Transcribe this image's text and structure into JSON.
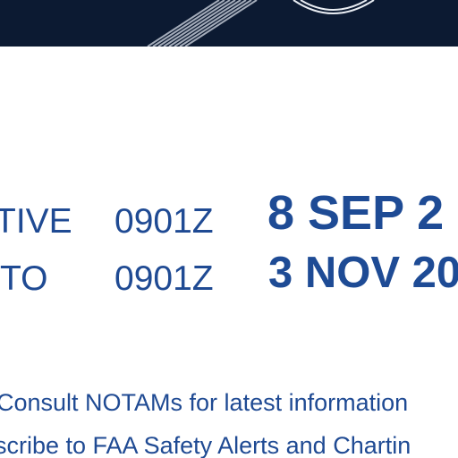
{
  "effective": {
    "label": "TIVE",
    "time": "0901Z",
    "date": "8 SEP 2"
  },
  "expires": {
    "label": "TO",
    "time": "0901Z",
    "date": "3 NOV 20"
  },
  "notes": [
    "Consult NOTAMs for latest information",
    "scribe to FAA Safety Alerts and Chartin"
  ],
  "colors": {
    "header_bg": "#0c1a32",
    "text_blue": "#1f4a93"
  }
}
